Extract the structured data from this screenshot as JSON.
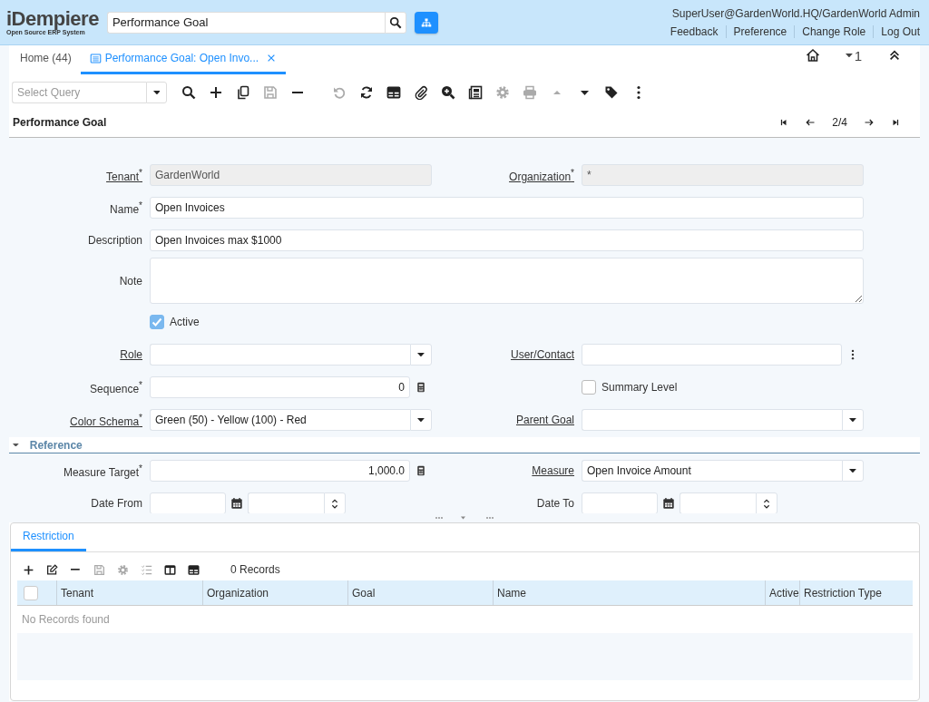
{
  "header": {
    "logo": {
      "title": "iDempiere",
      "subtitle": "Open Source ERP System"
    },
    "search": {
      "value": "Performance Goal"
    },
    "user": "SuperUser@GardenWorld.HQ/GardenWorld Admin",
    "links": [
      "Feedback",
      "Preference",
      "Change Role",
      "Log Out"
    ]
  },
  "tabs": [
    {
      "label": "Home (44)",
      "selected": false,
      "closable": false
    },
    {
      "label": "Performance Goal: Open Invo...",
      "selected": true,
      "closable": true
    }
  ],
  "window_count": "1",
  "toolbar": {
    "query": {
      "placeholder": "Select Query"
    },
    "groups": [
      [
        {
          "kind": "search",
          "disabled": false
        },
        {
          "kind": "new",
          "disabled": false
        },
        {
          "kind": "copy",
          "disabled": false
        },
        {
          "kind": "save",
          "disabled": true
        },
        {
          "kind": "delete",
          "disabled": false
        }
      ],
      [
        {
          "kind": "undo",
          "disabled": true
        },
        {
          "kind": "refresh",
          "disabled": false
        },
        {
          "kind": "grid",
          "disabled": false
        },
        {
          "kind": "attach",
          "disabled": false
        },
        {
          "kind": "zoom",
          "disabled": false
        },
        {
          "kind": "report",
          "disabled": false
        },
        {
          "kind": "gear",
          "disabled": true
        },
        {
          "kind": "print",
          "disabled": true
        },
        {
          "kind": "up",
          "disabled": true
        },
        {
          "kind": "down",
          "disabled": false
        },
        {
          "kind": "tag",
          "disabled": false
        },
        {
          "kind": "more",
          "disabled": false
        }
      ]
    ]
  },
  "record": {
    "title": "Performance Goal",
    "position": "2/4"
  },
  "form": {
    "items": [
      {
        "kind": "row",
        "fields": [
          {
            "kind": "text",
            "label": "Tenant$^{*}$",
            "link": true,
            "readonly": true,
            "value": "GardenWorld"
          },
          {
            "kind": "text",
            "label": "Organization$^{*}$",
            "link": true,
            "readonly": true,
            "value": "*"
          }
        ]
      },
      {
        "kind": "row",
        "fields": [
          {
            "kind": "text",
            "label": "Name$^{*}$",
            "link": false,
            "readonly": false,
            "wide": true,
            "value": "Open Invoices"
          }
        ]
      },
      {
        "kind": "row",
        "fields": [
          {
            "kind": "text",
            "label": "Description",
            "link": false,
            "readonly": false,
            "wide": true,
            "value": "Open Invoices max $1000"
          }
        ]
      },
      {
        "kind": "row",
        "fields": [
          {
            "kind": "textarea",
            "label": "Note",
            "link": false,
            "readonly": false,
            "wide": true
          }
        ]
      },
      {
        "kind": "row",
        "fields": [
          {
            "kind": "checkbox",
            "label": "Active",
            "checked": true
          }
        ]
      },
      {
        "kind": "row",
        "fields": [
          {
            "kind": "select",
            "label": "Role",
            "link": true,
            "readonly": false
          },
          {
            "kind": "search",
            "label": "User/Contact",
            "link": true,
            "readonly": false
          }
        ]
      },
      {
        "kind": "row",
        "fields": [
          {
            "kind": "number",
            "label": "Sequence$^{*}$",
            "link": false,
            "readonly": false,
            "value": "0"
          },
          {
            "kind": "checkbox",
            "label": "Summary Level",
            "checked": false
          }
        ]
      },
      {
        "kind": "row",
        "fields": [
          {
            "kind": "select",
            "label": "Color Schema$^{*}$",
            "link": true,
            "readonly": false,
            "value": "Green (50) - Yellow (100) - Red"
          },
          {
            "kind": "select",
            "label": "Parent Goal",
            "link": true,
            "readonly": false
          }
        ]
      },
      {
        "kind": "section",
        "label": "Reference",
        "expanded": true
      },
      {
        "kind": "row",
        "fields": [
          {
            "kind": "number",
            "label": "Measure Target$^{*}$",
            "link": false,
            "readonly": false,
            "value": "1,000.0"
          },
          {
            "kind": "select",
            "label": "Measure",
            "link": true,
            "readonly": false,
            "value": "Open Invoice Amount"
          }
        ]
      },
      {
        "kind": "row",
        "fields": [
          {
            "kind": "datetime",
            "label": "Date From",
            "link": false,
            "readonly": false
          },
          {
            "kind": "datetime",
            "label": "Date To",
            "link": false,
            "readonly": false
          }
        ]
      }
    ]
  },
  "detail": {
    "tabs": [
      {
        "label": "Restriction",
        "selected": true
      }
    ],
    "toolbar": [
      {
        "kind": "new",
        "disabled": false
      },
      {
        "kind": "edit",
        "disabled": false
      },
      {
        "kind": "delete",
        "disabled": false
      },
      {
        "kind": "save",
        "disabled": true
      },
      {
        "kind": "gear",
        "disabled": true
      },
      {
        "kind": "list",
        "disabled": true
      },
      {
        "kind": "columns",
        "disabled": false
      },
      {
        "kind": "grid",
        "disabled": false
      }
    ],
    "record_count": "0 Records",
    "select_all_checked": false,
    "columns": [
      "Tenant",
      "Organization",
      "Goal",
      "Name",
      "Active",
      "Restriction Type"
    ],
    "empty_text": "No Records found"
  }
}
